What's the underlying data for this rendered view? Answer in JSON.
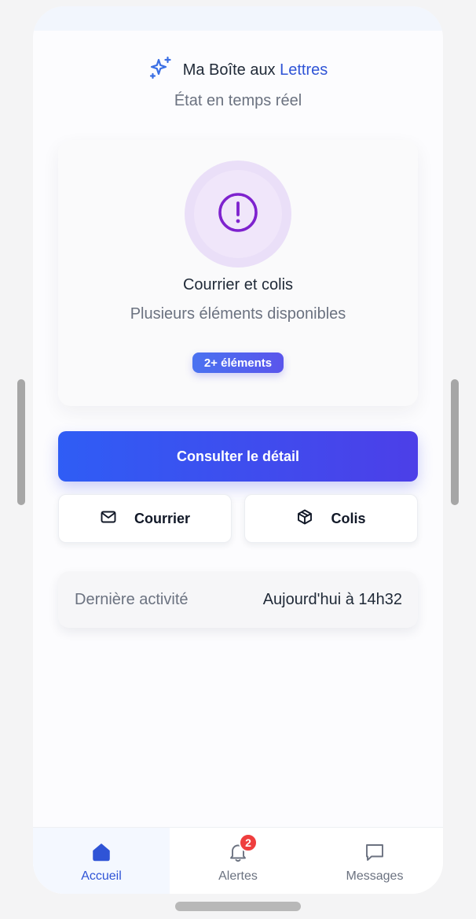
{
  "header": {
    "title_part1": "Ma Boîte aux",
    "title_part2": "Lettres",
    "subtitle": "État en temps réel",
    "icon": "sparkles-icon"
  },
  "status": {
    "icon": "alert-circle-icon",
    "title": "Courrier et colis",
    "description": "Plusieurs éléments disponibles",
    "badge": "2+ éléments"
  },
  "actions": {
    "primary_label": "Consulter le détail",
    "mail_label": "Courrier",
    "mail_icon": "mail-icon",
    "parcel_label": "Colis",
    "parcel_icon": "package-icon"
  },
  "activity": {
    "label": "Dernière activité",
    "value": "Aujourd'hui à 14h32"
  },
  "tabs": [
    {
      "label": "Accueil",
      "icon": "home-icon",
      "active": true
    },
    {
      "label": "Alertes",
      "icon": "bell-icon",
      "badge": "2"
    },
    {
      "label": "Messages",
      "icon": "message-icon"
    }
  ],
  "colors": {
    "accent": "#2f54d6",
    "primary_gradient_start": "#2f5df5",
    "primary_gradient_end": "#4c3fe8",
    "status_purple": "#7e22ce",
    "alert_red": "#ef3e3e"
  }
}
